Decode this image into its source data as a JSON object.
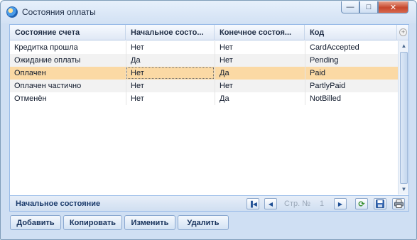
{
  "window": {
    "title": "Состояния оплаты",
    "icon": "globe-icon",
    "controls": {
      "minimize": "—",
      "maximize": "□",
      "close": "✕"
    }
  },
  "grid": {
    "columns": [
      "Состояние счета",
      "Начальное состо...",
      "Конечное состоя...",
      "Код"
    ],
    "add_column_glyph": "+",
    "rows": [
      {
        "state": "Кредитка прошла",
        "initial": "Нет",
        "final": "Нет",
        "code": "CardAccepted"
      },
      {
        "state": "Ожидание оплаты",
        "initial": "Да",
        "final": "Нет",
        "code": "Pending"
      },
      {
        "state": "Оплачен",
        "initial": "Нет",
        "final": "Да",
        "code": "Paid"
      },
      {
        "state": "Оплачен частично",
        "initial": "Нет",
        "final": "Нет",
        "code": "PartlyPaid"
      },
      {
        "state": "Отменён",
        "initial": "Нет",
        "final": "Да",
        "code": "NotBilled"
      }
    ],
    "selected_row": 2,
    "footer": {
      "group_label": "Начальное состояние",
      "page_label": "Стр. №",
      "page_number": "1"
    }
  },
  "toolbar": {
    "add": "Добавить",
    "copy": "Копировать",
    "edit": "Изменить",
    "delete": "Удалить"
  },
  "colors": {
    "selected_row": "#fbd9a4",
    "alt_row": "#f2f2f2",
    "frame": "#cfdff3"
  }
}
